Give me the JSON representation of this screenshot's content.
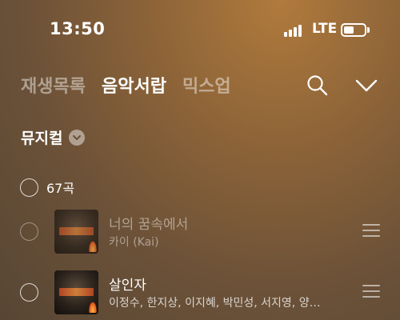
{
  "status_bar": {
    "time": "13:50",
    "network": "LTE",
    "icons": [
      "signal-icon",
      "battery-icon"
    ]
  },
  "header": {
    "tabs": [
      {
        "label": "재생목록",
        "active": false
      },
      {
        "label": "음악서랍",
        "active": true
      },
      {
        "label": "믹스업",
        "active": false
      }
    ],
    "icons": [
      "search-icon",
      "chevron-down-icon"
    ]
  },
  "category": {
    "label": "뮤지컬",
    "icon": "chevron-down-icon"
  },
  "list": {
    "count_label": "67곡",
    "songs": [
      {
        "title": "너의 꿈속에서",
        "artist": "카이 (Kai)",
        "dimmed": true
      },
      {
        "title": "살인자",
        "artist": "이정수, 한지상, 이지혜, 박민성, 서지영, 양…",
        "dimmed": false
      }
    ]
  },
  "colors": {
    "background_top": "#b07a3c",
    "background_bottom": "#574634",
    "text": "#ffffff"
  }
}
